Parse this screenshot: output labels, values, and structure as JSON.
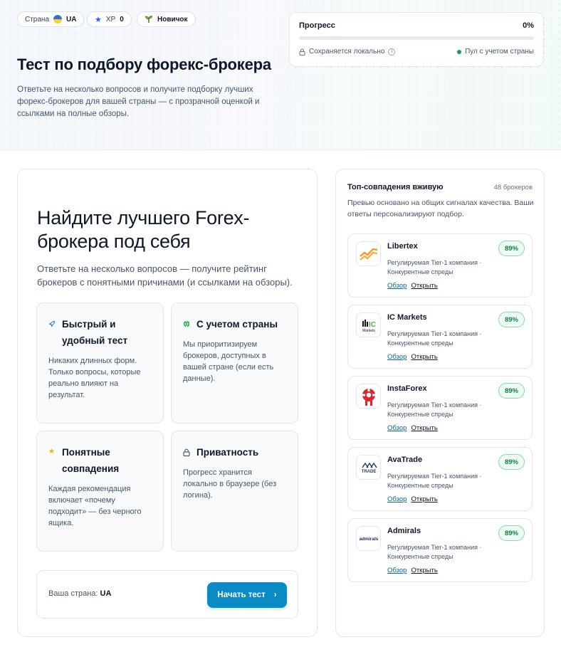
{
  "header": {
    "country_chip": {
      "label": "Страна",
      "value": "UA"
    },
    "xp_chip": {
      "label": "XP",
      "value": "0"
    },
    "level_chip": {
      "label": "Новичок"
    },
    "title": "Тест по подбору форекс-брокера",
    "lead": "Ответьте на несколько вопросов и получите подборку лучших форекс-брокеров для вашей страны — с прозрачной оценкой и ссылками на полные обзоры."
  },
  "progress": {
    "label": "Прогресс",
    "percent_text": "0%",
    "value": 0,
    "saved_note": "Сохраняется локально",
    "pool_note": "Пул с учетом страны"
  },
  "main": {
    "title": "Найдите лучшего Forex-брокера под себя",
    "subtitle": "Ответьте на несколько вопросов — получите рейтинг брокеров с понятными причинами (и ссылками на обзоры).",
    "features": [
      {
        "title": "Быстрый и удобный тест",
        "text": "Никаких длинных форм. Только вопросы, которые реально влияют на результат.",
        "icon": "rocket-icon"
      },
      {
        "title": "С учетом страны",
        "text": "Мы приоритизируем брокеров, доступных в вашей стране (если есть данные).",
        "icon": "globe-icon"
      },
      {
        "title": "Понятные совпадения",
        "text": "Каждая рекомендация включает «почему подходит» — без черного ящика.",
        "icon": "star-icon"
      },
      {
        "title": "Приватность",
        "text": "Прогресс хранится локально в браузере (без логина).",
        "icon": "lock-icon"
      }
    ],
    "country_label": "Ваша страна:",
    "country_value": "UA",
    "start_button": "Начать тест",
    "start_arrow": "›"
  },
  "sidebar": {
    "title": "Топ-совпадения вживую",
    "count": "48 брокеров",
    "note": "Превью основано на общих сигналах качества. Ваши ответы персонализируют подбор.",
    "brokers": [
      {
        "name": "Libertex",
        "match": "89%",
        "desc": "Регулируемая Tier-1 компания · Конкурентные спреды",
        "review": "Обзор",
        "open": "Открыть"
      },
      {
        "name": "IC Markets",
        "match": "89%",
        "desc": "Регулируемая Tier-1 компания · Конкурентные спреды",
        "review": "Обзор",
        "open": "Открыть",
        "logo_text": "Markets"
      },
      {
        "name": "InstaForex",
        "match": "89%",
        "desc": "Регулируемая Tier-1 компания · Конкурентные спреды",
        "review": "Обзор",
        "open": "Открыть"
      },
      {
        "name": "AvaTrade",
        "match": "89%",
        "desc": "Регулируемая Tier-1 компания · Конкурентные спреды",
        "review": "Обзор",
        "open": "Открыть",
        "logo_text": "TRADE"
      },
      {
        "name": "Admirals",
        "match": "89%",
        "desc": "Регулируемая Tier-1 компания · Конкурентные спреды",
        "review": "Обзор",
        "open": "Открыть",
        "logo_text": "admirals"
      }
    ]
  },
  "colors": {
    "accent": "#0a8bc6",
    "match_badge": "#15803d",
    "status_dot": "#16a34a"
  }
}
